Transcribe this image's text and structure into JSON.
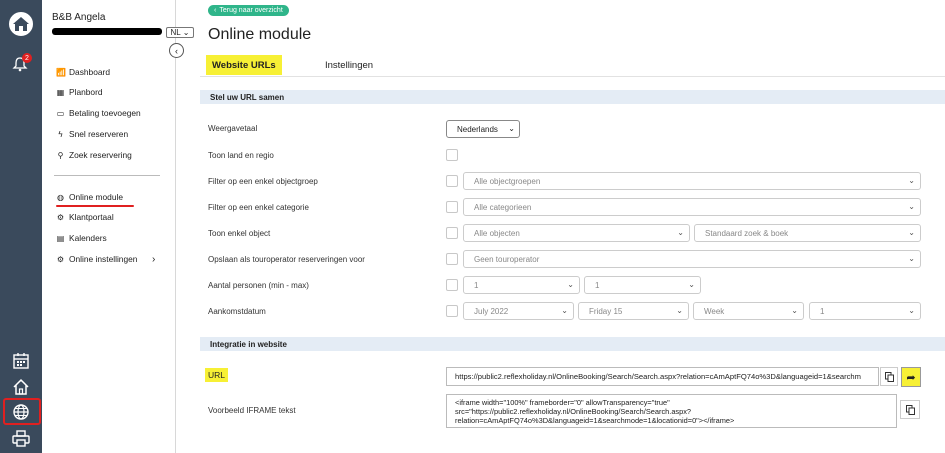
{
  "sidebar": {
    "name": "B&B Angela",
    "lang": "NL",
    "notifications": "2",
    "items": [
      {
        "label": "Dashboard"
      },
      {
        "label": "Planbord"
      },
      {
        "label": "Betaling toevoegen"
      },
      {
        "label": "Snel reserveren"
      },
      {
        "label": "Zoek reservering"
      },
      {
        "label": "Online module"
      },
      {
        "label": "Klantportaal"
      },
      {
        "label": "Kalenders"
      },
      {
        "label": "Online instellingen"
      }
    ]
  },
  "header": {
    "back": "Terug naar overzicht",
    "title": "Online module",
    "tabs": [
      "Website URLs",
      "Instellingen"
    ]
  },
  "sections": {
    "compose": "Stel uw URL samen",
    "integration": "Integratie in website"
  },
  "form": {
    "language_label": "Weergavetaal",
    "language_value": "Nederlands",
    "country_label": "Toon land en regio",
    "objgroup_label": "Filter op een enkel objectgroep",
    "objgroup_value": "Alle objectgroepen",
    "category_label": "Filter op een enkel categorie",
    "category_value": "Alle categorieen",
    "object_label": "Toon enkel object",
    "object_value": "Alle objecten",
    "search_value": "Standaard zoek & boek",
    "touroperator_label": "Opslaan als touroperator reserveringen voor",
    "touroperator_value": "Geen touroperator",
    "persons_label": "Aantal personen (min - max)",
    "persons_min": "1",
    "persons_max": "1",
    "arrival_label": "Aankomstdatum",
    "arrival_month": "July 2022",
    "arrival_day": "Friday 15",
    "arrival_period": "Week",
    "arrival_count": "1"
  },
  "integration": {
    "url_label": "URL",
    "url_value": "https://public2.reflexholiday.nl/OnlineBooking/Search/Search.aspx?relation=cAmAptFQ74o%3D&languageid=1&searchm",
    "iframe_label": "Voorbeeld IFRAME tekst",
    "iframe_line1": "<iframe width=\"100%\" frameborder=\"0\" allowTransparency=\"true\"",
    "iframe_line2": "src=\"https://public2.reflexholiday.nl/OnlineBooking/Search/Search.aspx?",
    "iframe_line3": "relation=cAmAptFQ74o%3D&languageid=1&searchmode=1&locationid=0\"></iframe>"
  },
  "colors": {
    "rail": "#3a4a5c",
    "highlight": "#f7f035",
    "accent_green": "#2fb58a",
    "annotation_red": "#e02020",
    "section_bg": "#e4ecf5"
  },
  "icons": {
    "logo": "home-logo-icon",
    "bell": "bell-icon",
    "calendar": "calendar-icon",
    "home": "home-icon",
    "globe": "globe-icon",
    "printer": "printer-icon"
  }
}
